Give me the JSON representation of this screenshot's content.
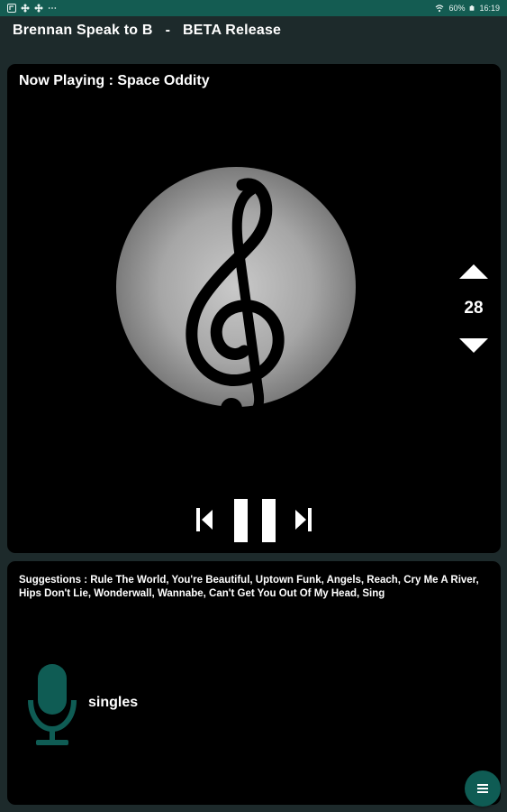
{
  "status_bar": {
    "left_icons": [
      "app-notification-icon",
      "flower-icon",
      "flower-icon",
      "more-dots-icon"
    ],
    "battery": "60%",
    "time": "16:19",
    "right_icons": [
      "wifi-icon",
      "battery-icon"
    ]
  },
  "app": {
    "title": "Brennan Speak to B   -   BETA Release"
  },
  "player": {
    "now_playing": "Now Playing : Space Oddity",
    "artwork_icon": "treble-clef-icon",
    "volume": "28",
    "controls": [
      "previous-icon",
      "pause-icon",
      "next-icon"
    ]
  },
  "suggestions": {
    "text": "Suggestions : Rule The World, You're Beautiful, Uptown Funk, Angels, Reach, Cry Me A River, Hips Don't Lie, Wonderwall, Wannabe, Can't Get You Out Of My Head, Sing"
  },
  "voice": {
    "recognized_text": "singles",
    "mic_icon": "microphone-icon"
  },
  "fab": {
    "icon": "menu-icon"
  },
  "colors": {
    "background": "#1d2a2b",
    "status_bar": "#145c52",
    "accent": "#0f5c54",
    "card": "#000000"
  }
}
